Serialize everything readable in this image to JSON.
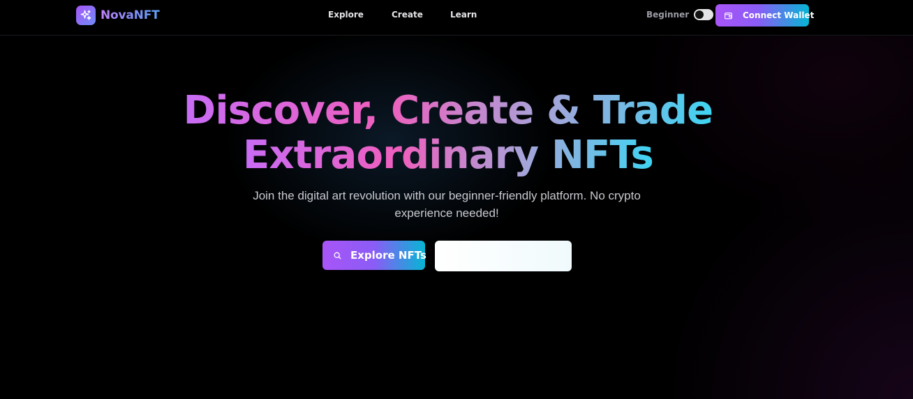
{
  "brand": {
    "name": "NovaNFT",
    "logo_icon": "sparkles-icon"
  },
  "nav": {
    "items": [
      {
        "label": "Explore"
      },
      {
        "label": "Create"
      },
      {
        "label": "Learn"
      }
    ]
  },
  "experience": {
    "label": "Beginner",
    "toggle_on": false
  },
  "wallet": {
    "label": "Connect Wallet",
    "icon": "wallet-icon"
  },
  "hero": {
    "title_line1": "Discover, Create & Trade",
    "title_line2": "Extraordinary NFTs",
    "subtitle": "Join the digital art revolution with our beginner-friendly platform. No crypto experience needed!",
    "primary_button": {
      "label": "Explore NFTs",
      "icon": "search-icon"
    },
    "secondary_button": {
      "label": ""
    }
  },
  "colors": {
    "accent_purple": "#a855f7",
    "accent_cyan": "#06b6d4",
    "background": "#000000"
  }
}
